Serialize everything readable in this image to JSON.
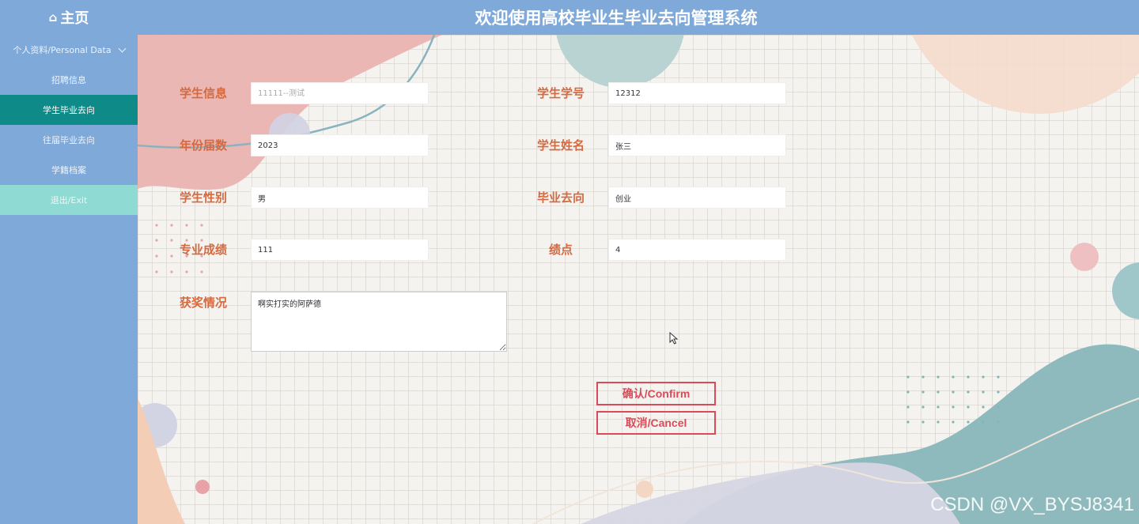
{
  "header": {
    "home_icon": "home-icon",
    "home_label": "主页",
    "title": "欢迎使用高校毕业生毕业去向管理系统"
  },
  "sidebar": {
    "items": [
      {
        "label": "个人资料/Personal Data",
        "expandable": true
      },
      {
        "label": "招聘信息"
      },
      {
        "label": "学生毕业去向",
        "active": true
      },
      {
        "label": "往届毕业去向"
      },
      {
        "label": "学籍档案"
      },
      {
        "label": "退出/Exit"
      }
    ]
  },
  "form": {
    "student_info": {
      "label": "学生信息",
      "placeholder": "11111--测试",
      "value": ""
    },
    "student_no": {
      "label": "学生学号",
      "value": "12312"
    },
    "year": {
      "label": "年份届数",
      "value": "2023"
    },
    "name": {
      "label": "学生姓名",
      "value": "张三"
    },
    "gender": {
      "label": "学生性别",
      "value": "男"
    },
    "destination": {
      "label": "毕业去向",
      "value": "创业"
    },
    "score": {
      "label": "专业成绩",
      "value": "111"
    },
    "gpa": {
      "label": "绩点",
      "value": "4"
    },
    "awards": {
      "label": "获奖情况",
      "value": "啊实打实的阿萨德"
    }
  },
  "buttons": {
    "confirm": "确认/Confirm",
    "cancel": "取消/Cancel"
  },
  "watermark": "CSDN @VX_BYSJ8341",
  "colors": {
    "header_bg": "#7fa9d9",
    "active_item": "#0e8a89",
    "exit_item": "#8fdad2",
    "label": "#d5693f",
    "button": "#d94b58"
  }
}
